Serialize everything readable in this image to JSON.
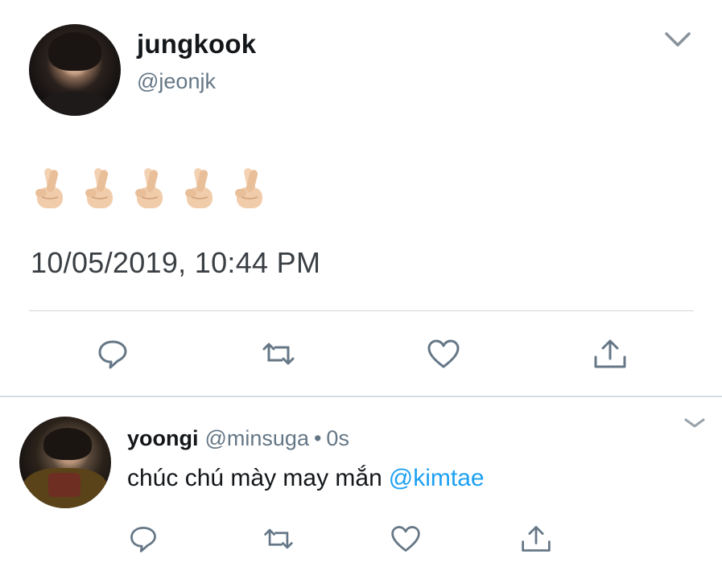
{
  "main_tweet": {
    "display_name": "jungkook",
    "handle": "@jeonjk",
    "emoji_text": "🤞🏻🤞🏻🤞🏻🤞🏻🤞🏻",
    "emoji_count": 5,
    "timestamp": "10/05/2019, 10:44 PM",
    "actions": [
      "reply-icon",
      "retweet-icon",
      "like-icon",
      "share-icon"
    ]
  },
  "reply_tweet": {
    "display_name": "yoongi",
    "handle": "@minsuga",
    "separator": "•",
    "time": "0s",
    "text": "chúc chú mày may mắn",
    "mention": "@kimtae",
    "actions": [
      "reply-icon",
      "retweet-icon",
      "like-icon",
      "share-icon"
    ]
  },
  "colors": {
    "text_primary": "#14171a",
    "text_secondary": "#657786",
    "mention_blue": "#1da1f2",
    "icon_gray": "#657786",
    "divider": "#cfd5da"
  }
}
